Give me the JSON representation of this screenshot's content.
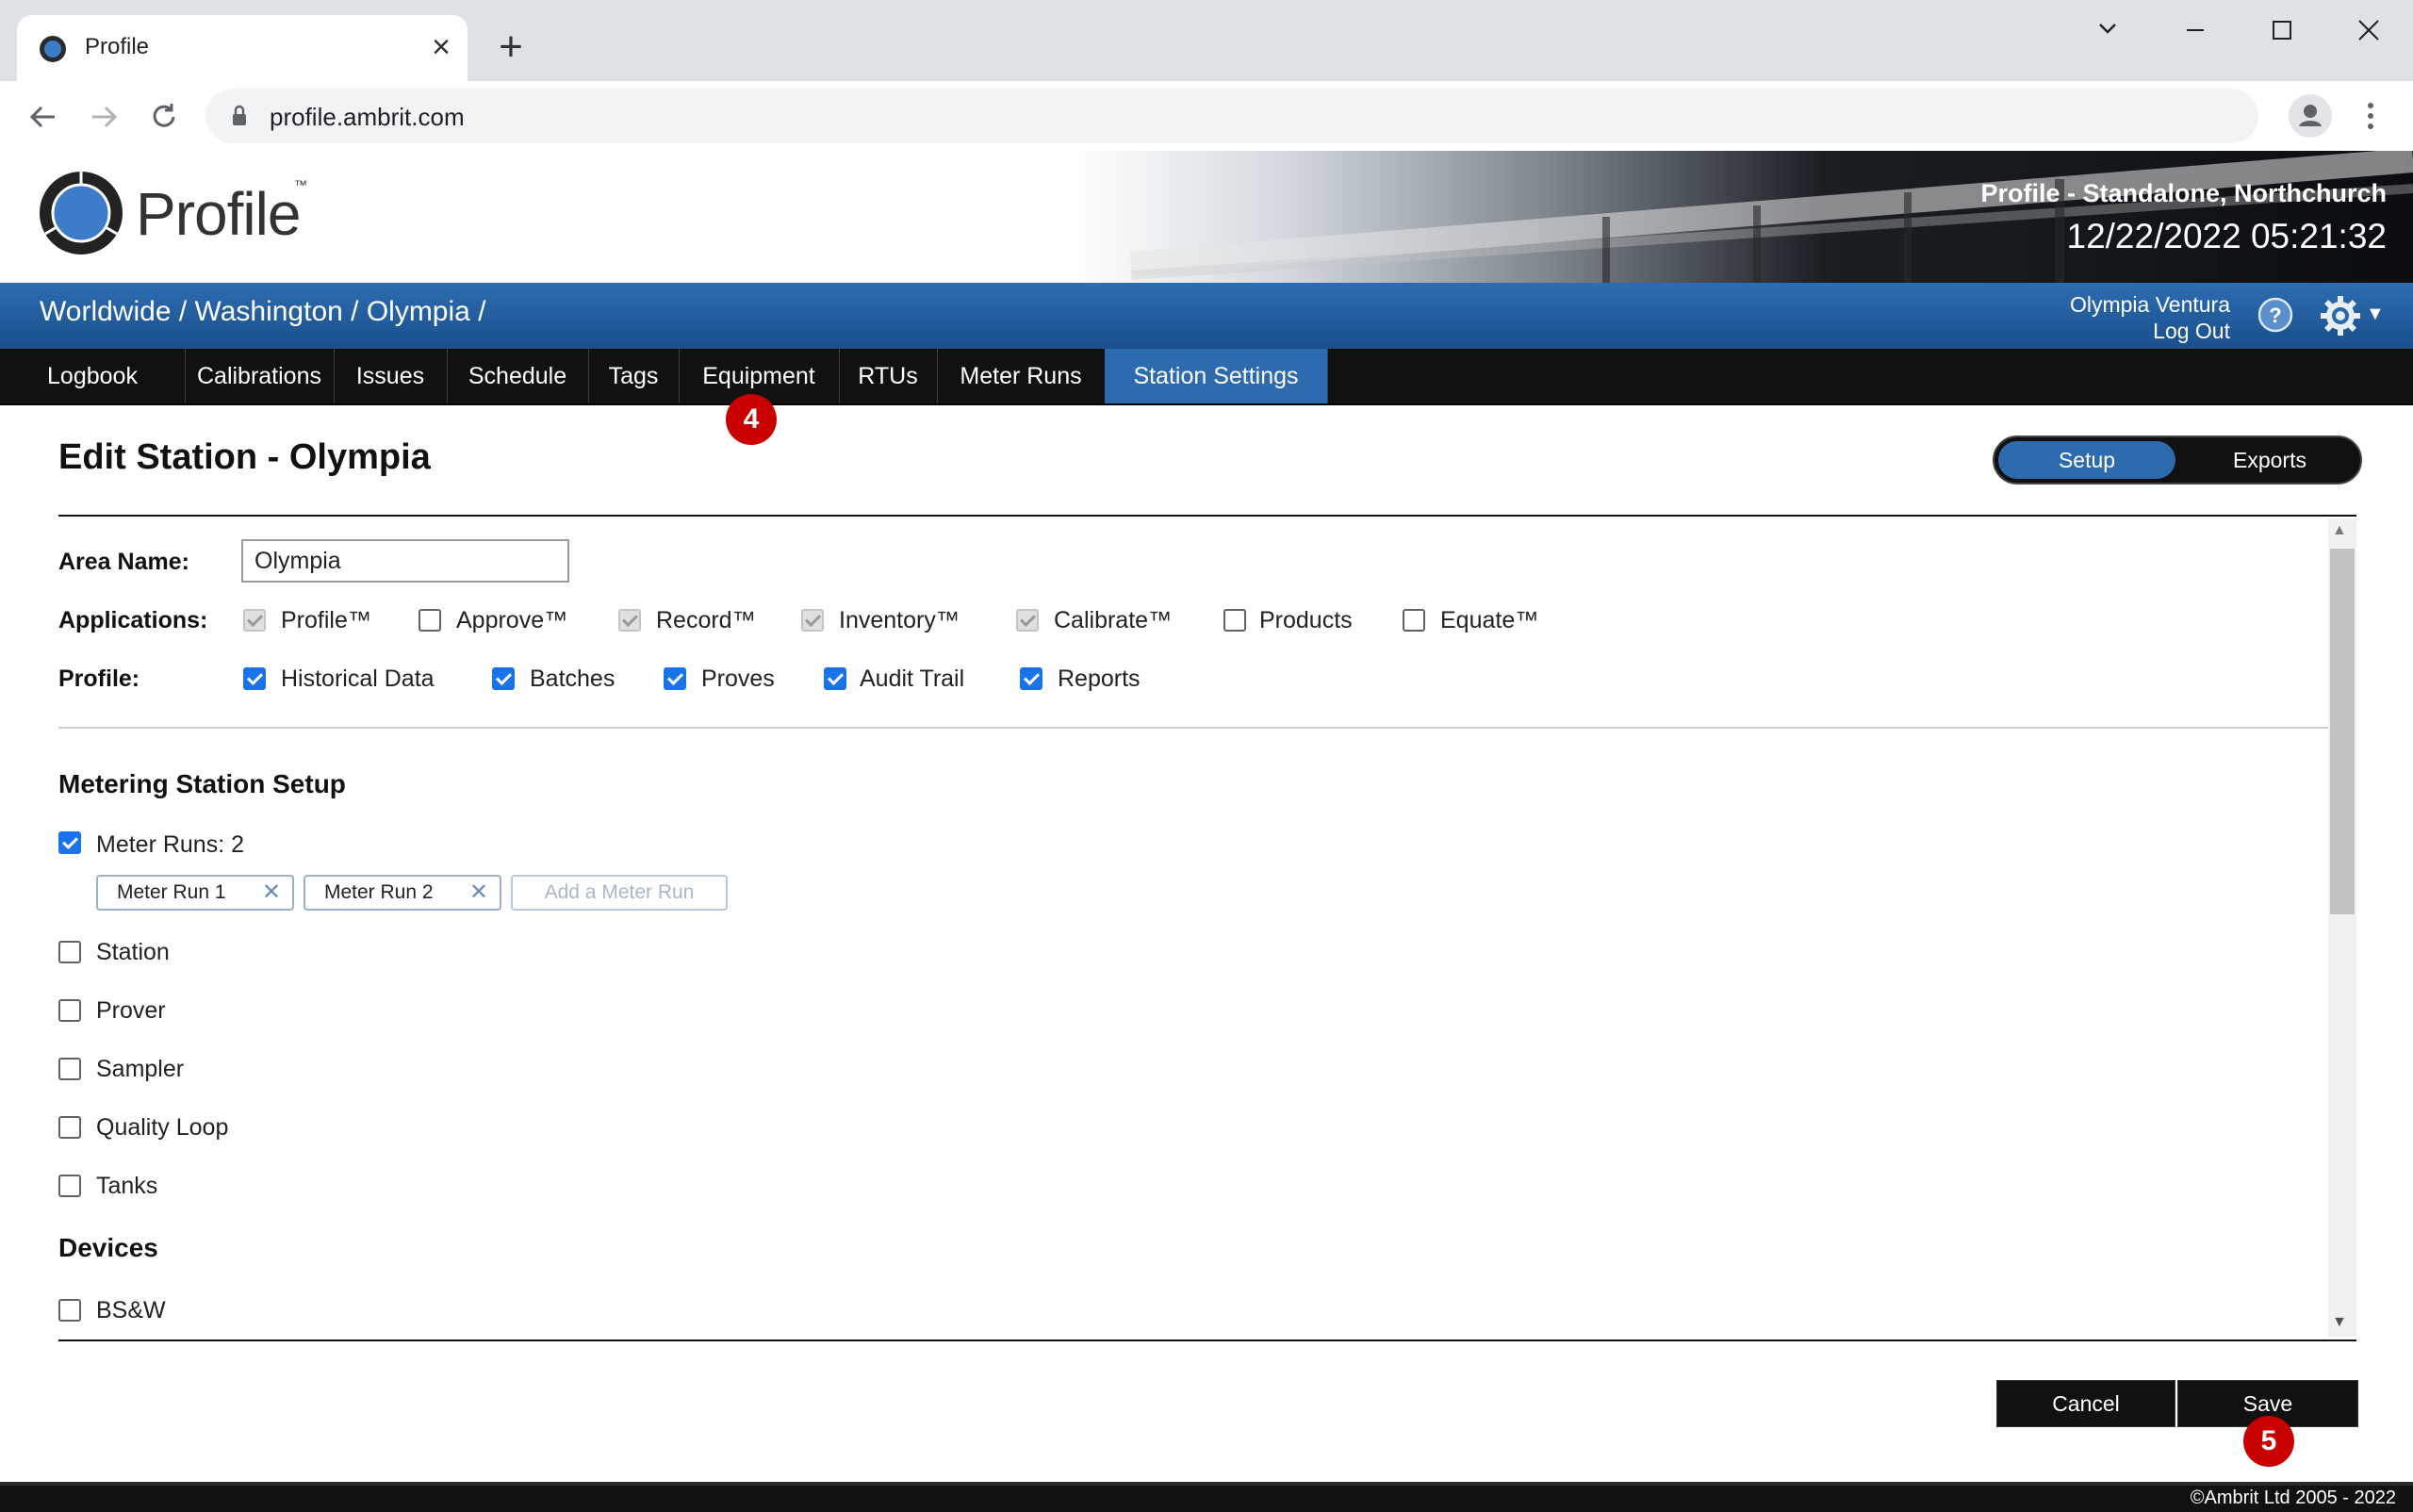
{
  "browser": {
    "tab_title": "Profile",
    "url": "profile.ambrit.com"
  },
  "header": {
    "logo_text": "Profile",
    "logo_tm": "™",
    "station_label": "Profile - Standalone, Northchurch",
    "datetime": "12/22/2022 05:21:32"
  },
  "bluebar": {
    "breadcrumb": "Worldwide / Washington / Olympia /",
    "user_name": "Olympia Ventura",
    "logout": "Log Out"
  },
  "nav": {
    "tabs": [
      {
        "label": "Logbook"
      },
      {
        "label": "Calibrations"
      },
      {
        "label": "Issues"
      },
      {
        "label": "Schedule"
      },
      {
        "label": "Tags"
      },
      {
        "label": "Equipment"
      },
      {
        "label": "RTUs"
      },
      {
        "label": "Meter Runs"
      },
      {
        "label": "Station Settings"
      }
    ],
    "active_tab": "Station Settings"
  },
  "badges": {
    "equipment": "4",
    "save": "5"
  },
  "page": {
    "title": "Edit Station - Olympia",
    "toggle": {
      "setup": "Setup",
      "exports": "Exports",
      "selected": "Setup"
    }
  },
  "form": {
    "area_name_label": "Area Name:",
    "area_name_value": "Olympia",
    "applications_label": "Applications:",
    "applications": [
      {
        "label": "Profile™",
        "checked": true,
        "disabled": true
      },
      {
        "label": "Approve™",
        "checked": false,
        "disabled": false
      },
      {
        "label": "Record™",
        "checked": true,
        "disabled": true
      },
      {
        "label": "Inventory™",
        "checked": true,
        "disabled": true
      },
      {
        "label": "Calibrate™",
        "checked": true,
        "disabled": true
      },
      {
        "label": "Products",
        "checked": false,
        "disabled": false
      },
      {
        "label": "Equate™",
        "checked": false,
        "disabled": false
      }
    ],
    "profile_label": "Profile:",
    "profile_options": [
      {
        "label": "Historical Data",
        "checked": true
      },
      {
        "label": "Batches",
        "checked": true
      },
      {
        "label": "Proves",
        "checked": true
      },
      {
        "label": "Audit Trail",
        "checked": true
      },
      {
        "label": "Reports",
        "checked": true
      }
    ]
  },
  "metering": {
    "title": "Metering Station Setup",
    "meter_runs_label": "Meter Runs: 2",
    "meter_runs_checked": true,
    "meter_run_chips": [
      "Meter Run 1",
      "Meter Run 2"
    ],
    "add_meter_run": "Add a Meter Run",
    "items": [
      {
        "label": "Station",
        "checked": false
      },
      {
        "label": "Prover",
        "checked": false
      },
      {
        "label": "Sampler",
        "checked": false
      },
      {
        "label": "Quality Loop",
        "checked": false
      },
      {
        "label": "Tanks",
        "checked": false
      }
    ]
  },
  "devices": {
    "title": "Devices",
    "items": [
      {
        "label": "BS&W",
        "checked": false
      }
    ]
  },
  "actions": {
    "cancel": "Cancel",
    "save": "Save"
  },
  "footer": {
    "copyright": "©Ambrit Ltd 2005 - 2022"
  }
}
